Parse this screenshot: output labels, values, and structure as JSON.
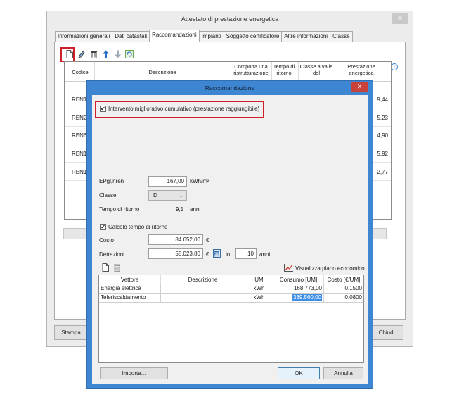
{
  "main_window": {
    "title": "Attestato di prestazione energetica",
    "close_glyph": "✕",
    "tabs": [
      "Informazioni generali",
      "Dati catastali",
      "Raccomandazioni",
      "Impianti",
      "Soggetto certificatore",
      "Altre informazioni",
      "Classe"
    ],
    "active_tab": "Raccomandazioni",
    "toolbar_icons": [
      "new-document-icon",
      "edit-icon",
      "delete-icon",
      "move-up-icon",
      "move-down-icon",
      "refresh-icon"
    ],
    "grid": {
      "columns": [
        "Codice",
        "Descrizione",
        "Comporta una ristrutturazione",
        "Tempo di ritorno",
        "Classe a valle del",
        "Prestazione energetica"
      ],
      "rows": [
        {
          "code": "REN1",
          "value": "9,44"
        },
        {
          "code": "REN2",
          "value": "5,23"
        },
        {
          "code": "REN6",
          "value": "4,90"
        },
        {
          "code": "REN1",
          "value": "5,92"
        },
        {
          "code": "REN1",
          "value": "2,77"
        }
      ]
    },
    "info_glyph": "i",
    "stampa_label": "Stampa",
    "chiudi_label": "Chiudi"
  },
  "dialog": {
    "title": "Raccomandazione",
    "close_glyph": "✕",
    "cumulative_label": "Intervento migliorativo cumulativo (prestazione raggiungibile)",
    "cumulative_checked": true,
    "epgl_label": "EPgl,nren",
    "epgl_value": "167,00",
    "epgl_unit": "kWh/m²",
    "classe_label": "Classe",
    "classe_value": "D",
    "tempo_label": "Tempo di ritorno",
    "tempo_value": "9,1",
    "tempo_unit": "anni",
    "calcolo_label": "Calcolo tempo di ritorno",
    "calcolo_checked": true,
    "costo_label": "Costo",
    "costo_value": "84.652,00",
    "costo_unit": "€",
    "detrazioni_label": "Detrazioni",
    "detrazioni_value": "55.023,80",
    "detrazioni_unit": "€",
    "in_label": "in",
    "years_value": "10",
    "years_unit": "anni",
    "piano_label": "Visualizza piano economico",
    "table": {
      "columns": [
        "Vettore",
        "Descrizione",
        "UM",
        "Consumo [UM]",
        "Costo [€/UM]"
      ],
      "rows": [
        {
          "vettore": "Energia elettrica",
          "descrizione": "",
          "um": "kWh",
          "consumo": "168.773,00",
          "costo": "0,1500"
        },
        {
          "vettore": "Teleriscaldamento",
          "descrizione": "",
          "um": "kWh",
          "consumo": "339.560,00",
          "costo": "0,0800"
        }
      ]
    },
    "importa_label": "Importa...",
    "ok_label": "OK",
    "annulla_label": "Annulla"
  },
  "colors": {
    "dialog_frame": "#3e86d2",
    "highlight_box": "#d01f2a",
    "selection": "#3d8ee6"
  }
}
